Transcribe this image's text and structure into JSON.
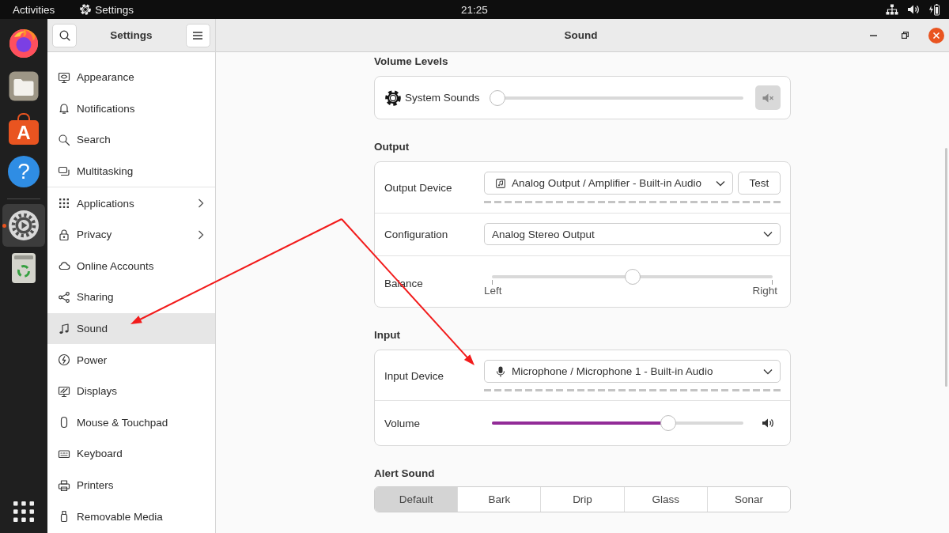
{
  "top_bar": {
    "activities": "Activities",
    "app_menu": "Settings",
    "clock": "21:25"
  },
  "dock": {
    "groups": [
      {
        "items": [
          {
            "kind": "browser",
            "selected": false,
            "running": false
          },
          {
            "kind": "files",
            "selected": false,
            "running": false
          },
          {
            "kind": "store",
            "glyph": "A",
            "selected": false,
            "running": false
          },
          {
            "kind": "help",
            "glyph": "?",
            "selected": false,
            "running": false
          }
        ]
      },
      {
        "items": [
          {
            "kind": "settings",
            "selected": true,
            "running": true
          },
          {
            "kind": "trash",
            "selected": false,
            "running": false
          }
        ]
      }
    ]
  },
  "sidebar": {
    "title": "Settings",
    "groups": [
      {
        "items": [
          {
            "label": "Appearance",
            "selected": false,
            "submenu": false
          },
          {
            "label": "Notifications",
            "selected": false,
            "submenu": false
          },
          {
            "label": "Search",
            "selected": false,
            "submenu": false
          },
          {
            "label": "Multitasking",
            "selected": false,
            "submenu": false
          }
        ]
      },
      {
        "items": [
          {
            "label": "Applications",
            "selected": false,
            "submenu": true
          },
          {
            "label": "Privacy",
            "selected": false,
            "submenu": true
          },
          {
            "label": "Online Accounts",
            "selected": false,
            "submenu": false
          },
          {
            "label": "Sharing",
            "selected": false,
            "submenu": false
          },
          {
            "label": "Sound",
            "selected": true,
            "submenu": false
          },
          {
            "label": "Power",
            "selected": false,
            "submenu": false
          },
          {
            "label": "Displays",
            "selected": false,
            "submenu": false
          },
          {
            "label": "Mouse & Touchpad",
            "selected": false,
            "submenu": false
          },
          {
            "label": "Keyboard",
            "selected": false,
            "submenu": false
          },
          {
            "label": "Printers",
            "selected": false,
            "submenu": false
          },
          {
            "label": "Removable Media",
            "selected": false,
            "submenu": false
          }
        ]
      }
    ]
  },
  "window": {
    "title": "Sound"
  },
  "volume_levels": {
    "heading": "Volume Levels",
    "streams": [
      {
        "label": "System Sounds",
        "level": 0,
        "muted": true
      }
    ]
  },
  "output": {
    "heading": "Output",
    "device": {
      "label": "Output Device",
      "value": "Analog Output / Amplifier - Built-in Audio"
    },
    "test_button": "Test",
    "configuration": {
      "label": "Configuration",
      "value": "Analog Stereo Output"
    },
    "balance": {
      "label": "Balance",
      "level": 0.5,
      "left": "Left",
      "right": "Right"
    }
  },
  "input": {
    "heading": "Input",
    "device": {
      "label": "Input Device",
      "value": "Microphone / Microphone 1 - Built-in Audio"
    },
    "volume": {
      "label": "Volume",
      "level": 0.7
    }
  },
  "alert_sound": {
    "heading": "Alert Sound",
    "options": [
      {
        "label": "Default",
        "selected": true
      },
      {
        "label": "Bark",
        "selected": false
      },
      {
        "label": "Drip",
        "selected": false
      },
      {
        "label": "Glass",
        "selected": false
      },
      {
        "label": "Sonar",
        "selected": false
      }
    ]
  },
  "annotations": [
    {
      "kind": "arrow"
    },
    {
      "kind": "arrow"
    }
  ]
}
